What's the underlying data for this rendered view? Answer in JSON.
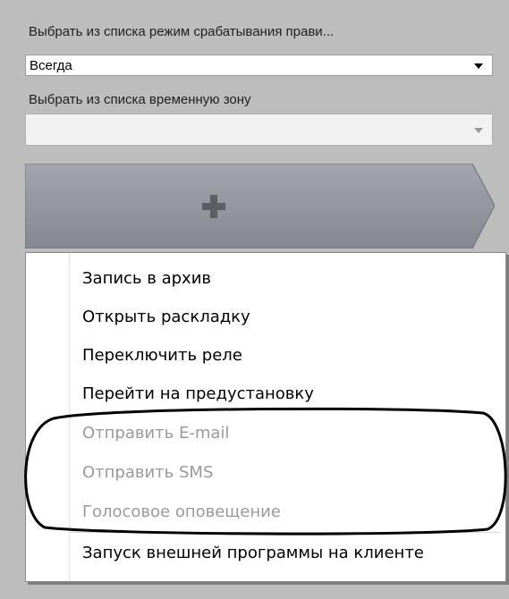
{
  "rule_mode": {
    "label": "Выбрать из списка режим срабатывания прави...",
    "value": "Всегда"
  },
  "time_zone": {
    "label": "Выбрать из списка временную зону",
    "value": ""
  },
  "add_button": {
    "icon": "plus-icon",
    "accent": "#8e8f9b"
  },
  "menu": {
    "items": [
      {
        "label": "Запись в архив",
        "enabled": true
      },
      {
        "label": "Открыть раскладку",
        "enabled": true
      },
      {
        "label": "Переключить реле",
        "enabled": true
      },
      {
        "label": "Перейти на предустановку",
        "enabled": true
      },
      {
        "label": "Отправить E-mail",
        "enabled": false
      },
      {
        "label": "Отправить SMS",
        "enabled": false
      },
      {
        "label": "Голосовое оповещение",
        "enabled": false
      },
      {
        "label": "Запуск внешней программы на клиенте",
        "enabled": true
      }
    ]
  }
}
